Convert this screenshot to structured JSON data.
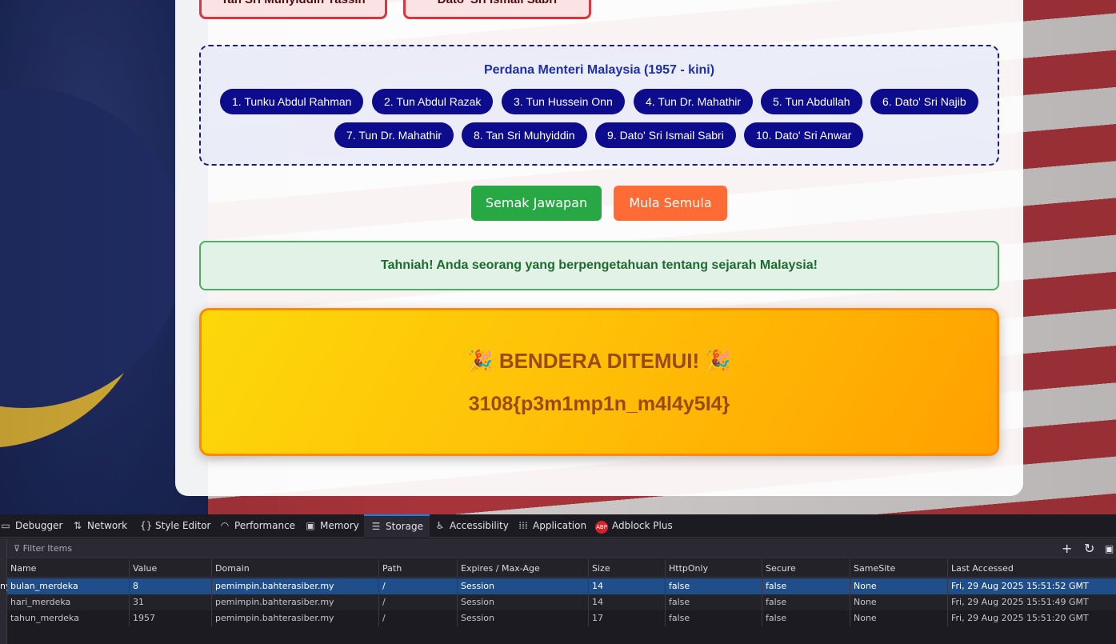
{
  "prev_buttons": [
    "Tan Sri Muhyiddin Yassin",
    "Dato' Sri Ismail Sabri"
  ],
  "pm_section": {
    "title": "Perdana Menteri Malaysia (1957 - kini)",
    "items": [
      "1. Tunku Abdul Rahman",
      "2. Tun Abdul Razak",
      "3. Tun Hussein Onn",
      "4. Tun Dr. Mahathir",
      "5. Tun Abdullah",
      "6. Dato' Sri Najib",
      "7. Tun Dr. Mahathir",
      "8. Tan Sri Muhyiddin",
      "9. Dato' Sri Ismail Sabri",
      "10. Dato' Sri Anwar"
    ]
  },
  "actions": {
    "check": "Semak Jawapan",
    "restart": "Mula Semula"
  },
  "message": "Tahniah! Anda seorang yang berpengetahuan tentang sejarah Malaysia!",
  "flag": {
    "title": "🎉 BENDERA DITEMUI! 🎉",
    "value": "3108{p3m1mp1n_m4l4y5I4}"
  },
  "colors": {
    "check": "#28a745",
    "restart": "#ff6b35",
    "pill": "#0c0c8c",
    "accent": "#0a84ff"
  },
  "devtools": {
    "tabs": [
      {
        "label": "Debugger",
        "icon": "debugger-icon"
      },
      {
        "label": "Network",
        "icon": "network-icon"
      },
      {
        "label": "Style Editor",
        "icon": "style-editor-icon"
      },
      {
        "label": "Performance",
        "icon": "performance-icon"
      },
      {
        "label": "Memory",
        "icon": "memory-icon"
      },
      {
        "label": "Storage",
        "icon": "storage-icon"
      },
      {
        "label": "Accessibility",
        "icon": "accessibility-icon"
      },
      {
        "label": "Application",
        "icon": "application-icon"
      },
      {
        "label": "Adblock Plus",
        "icon": "adblock-icon"
      }
    ],
    "active_tab": "Storage",
    "filter_placeholder": "Filter Items",
    "left_label": "ny",
    "columns": [
      "Name",
      "Value",
      "Domain",
      "Path",
      "Expires / Max-Age",
      "Size",
      "HttpOnly",
      "Secure",
      "SameSite",
      "Last Accessed"
    ],
    "rows": [
      [
        "bulan_merdeka",
        "8",
        "pemimpin.bahterasiber.my",
        "/",
        "Session",
        "14",
        "false",
        "false",
        "None",
        "Fri, 29 Aug 2025 15:51:52 GMT"
      ],
      [
        "hari_merdeka",
        "31",
        "pemimpin.bahterasiber.my",
        "/",
        "Session",
        "14",
        "false",
        "false",
        "None",
        "Fri, 29 Aug 2025 15:51:49 GMT"
      ],
      [
        "tahun_merdeka",
        "1957",
        "pemimpin.bahterasiber.my",
        "/",
        "Session",
        "17",
        "false",
        "false",
        "None",
        "Fri, 29 Aug 2025 15:51:20 GMT"
      ]
    ]
  }
}
